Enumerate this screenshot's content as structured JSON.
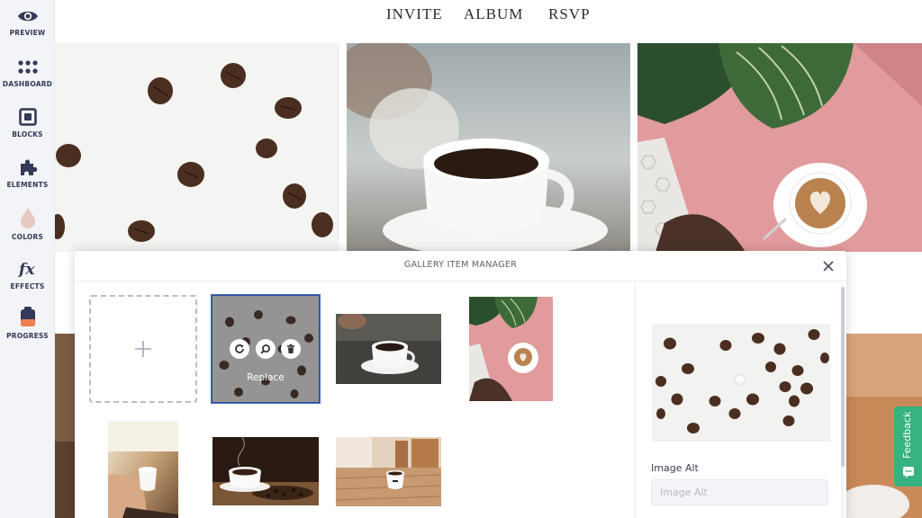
{
  "sidebar": {
    "items": [
      {
        "label": "PREVIEW",
        "icon": "eye-icon"
      },
      {
        "label": "DASHBOARD",
        "icon": "grid-dots-icon"
      },
      {
        "label": "BLOCKS",
        "icon": "blocks-icon"
      },
      {
        "label": "ELEMENTS",
        "icon": "puzzle-icon"
      },
      {
        "label": "COLORS",
        "icon": "droplet-icon"
      },
      {
        "label": "EFFECTS",
        "icon": "fx-icon"
      },
      {
        "label": "PROGRESS",
        "icon": "progress-bag-icon"
      }
    ]
  },
  "nav": {
    "links": [
      {
        "label": "INVITE"
      },
      {
        "label": "ALBUM"
      },
      {
        "label": "RSVP"
      }
    ]
  },
  "modal": {
    "title": "GALLERY ITEM MANAGER",
    "add_icon": "plus-icon",
    "selected_overlay": {
      "replace_label": "Replace",
      "buttons": [
        "rotate-icon",
        "zoom-icon",
        "trash-icon"
      ]
    },
    "thumbnails": [
      {
        "subject": "coffee beans on white"
      },
      {
        "subject": "coffee cup on saucer"
      },
      {
        "subject": "latte on pink table with leaves"
      },
      {
        "subject": "hand holding cup by window"
      },
      {
        "subject": "cup with scattered beans"
      },
      {
        "subject": "cup on wooden cafe table"
      }
    ],
    "alt_field": {
      "label": "Image Alt",
      "placeholder": "Image Alt",
      "value": ""
    }
  },
  "feedback": {
    "label": "Feedback"
  },
  "colors": {
    "sidebar_bg": "#f3f4f8",
    "sidebar_icon": "#333a57",
    "accent_selected": "#3f6ed0",
    "feedback_green": "#36b37e",
    "colors_drop": "#e5c8c0",
    "progress_orange": "#f07f52"
  }
}
